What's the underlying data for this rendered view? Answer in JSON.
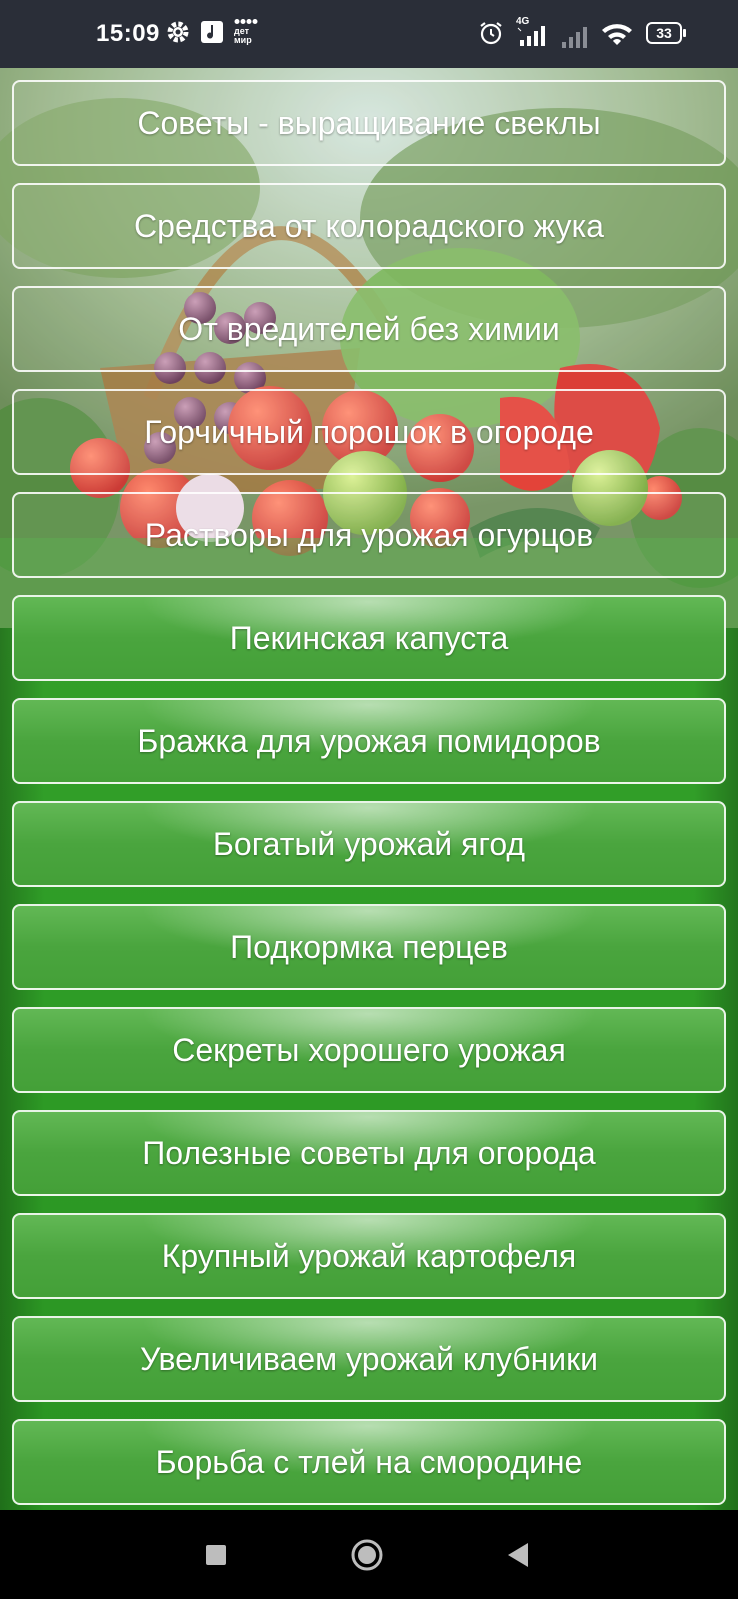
{
  "status_bar": {
    "time": "15:09",
    "icons": [
      "gear-icon",
      "music-note-icon",
      "detmir-app-icon",
      "alarm-icon",
      "signal-4g-icon",
      "signal-icon",
      "wifi-icon"
    ],
    "network_label": "4G",
    "app_badge": "дет мир",
    "battery_level": "33"
  },
  "menu": {
    "items": [
      {
        "label": "Советы - выращивание свеклы"
      },
      {
        "label": "Средства от колорадского жука"
      },
      {
        "label": "От вредителей без химии"
      },
      {
        "label": "Горчичный порошок в огороде"
      },
      {
        "label": "Растворы для урожая огурцов"
      },
      {
        "label": "Пекинская капуста"
      },
      {
        "label": "Бражка для урожая помидоров"
      },
      {
        "label": "Богатый урожай ягод"
      },
      {
        "label": "Подкормка перцев"
      },
      {
        "label": "Секреты хорошего урожая"
      },
      {
        "label": "Полезные советы для огорода"
      },
      {
        "label": "Крупный урожай картофеля"
      },
      {
        "label": "Увеличиваем урожай клубники"
      },
      {
        "label": "Борьба с тлей на смородине"
      }
    ]
  },
  "nav_bar": {
    "buttons": [
      "recents-square-icon",
      "home-circle-icon",
      "back-triangle-icon"
    ]
  },
  "colors": {
    "status_bar_bg": "#2a2e38",
    "button_green": "#4aa53e",
    "background_green": "#2e9c26",
    "nav_bar_bg": "#000000"
  }
}
